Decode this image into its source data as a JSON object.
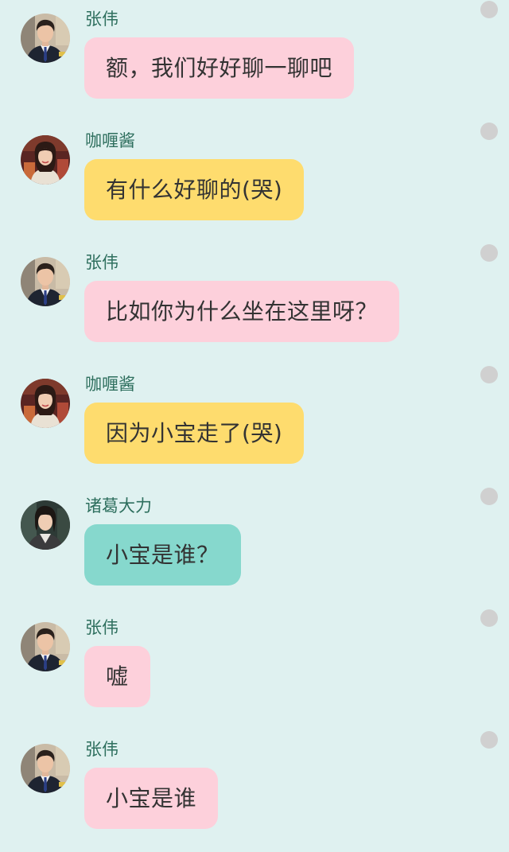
{
  "messages": [
    {
      "sender": "张伟",
      "text": "额，我们好好聊一聊吧",
      "bubble_color": "#fdd0db",
      "avatar": "zhangwei-avatar"
    },
    {
      "sender": "咖喱酱",
      "text": "有什么好聊的(哭)",
      "bubble_color": "#fedc6e",
      "avatar": "galijiang-avatar"
    },
    {
      "sender": "张伟",
      "text": "比如你为什么坐在这里呀？",
      "bubble_color": "#fdd0db",
      "avatar": "zhangwei-avatar"
    },
    {
      "sender": "咖喱酱",
      "text": "因为小宝走了(哭)",
      "bubble_color": "#fedc6e",
      "avatar": "galijiang-avatar"
    },
    {
      "sender": "诸葛大力",
      "text": "小宝是谁？",
      "bubble_color": "#86d8cd",
      "avatar": "zhugedali-avatar"
    },
    {
      "sender": "张伟",
      "text": "嘘",
      "bubble_color": "#fdd0db",
      "avatar": "zhangwei-avatar"
    },
    {
      "sender": "张伟",
      "text": "小宝是谁",
      "bubble_color": "#fdd0db",
      "avatar": "zhangwei-avatar"
    }
  ],
  "colors": {
    "background": "#dff1f0",
    "sender_name": "#2e6f5e",
    "message_text": "#333333",
    "status_dot": "#d0d0d0"
  }
}
